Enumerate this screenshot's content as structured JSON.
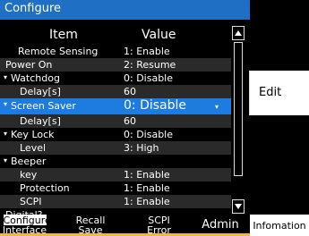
{
  "title": "Configure",
  "headers": {
    "item": "Item",
    "value": "Value"
  },
  "rows": [
    {
      "label": "Remote Sensing",
      "value": "1: Enable"
    },
    {
      "label": "Power On",
      "value": "2: Resume"
    },
    {
      "label": "Watchdog",
      "value": "0: Disable",
      "expander": "▾"
    },
    {
      "label": "Delay[s]",
      "value": "60"
    },
    {
      "label": "Screen Saver",
      "value": "0: Disable",
      "expander": "▾",
      "selected": true
    },
    {
      "label": "Delay[s]",
      "value": "60"
    },
    {
      "label": "Key Lock",
      "value": "0: Disable",
      "expander": "▾"
    },
    {
      "label": "Level",
      "value": "3: High"
    },
    {
      "label": "Beeper",
      "value": "",
      "expander": "▾"
    },
    {
      "label": "key",
      "value": "1: Enable"
    },
    {
      "label": "Protection",
      "value": "1: Enable"
    },
    {
      "label": "SCPI",
      "value": "1: Enable"
    },
    {
      "label": "Digital?",
      "value": ""
    }
  ],
  "right_panel": {
    "edit_label": "Edit"
  },
  "softkeys": [
    {
      "line1": "Configure",
      "line2": "Interface",
      "active": true
    },
    {
      "line1": "Recall",
      "line2": "Save"
    },
    {
      "line1": "SCPI",
      "line2": "Error"
    },
    {
      "single": "Admin"
    },
    {
      "single": "Infomation"
    }
  ],
  "dropdown_caret": "▾",
  "colors": {
    "title": "#1f6fc4",
    "selection": "#1e7ce0",
    "accent": "#f2b63b"
  }
}
